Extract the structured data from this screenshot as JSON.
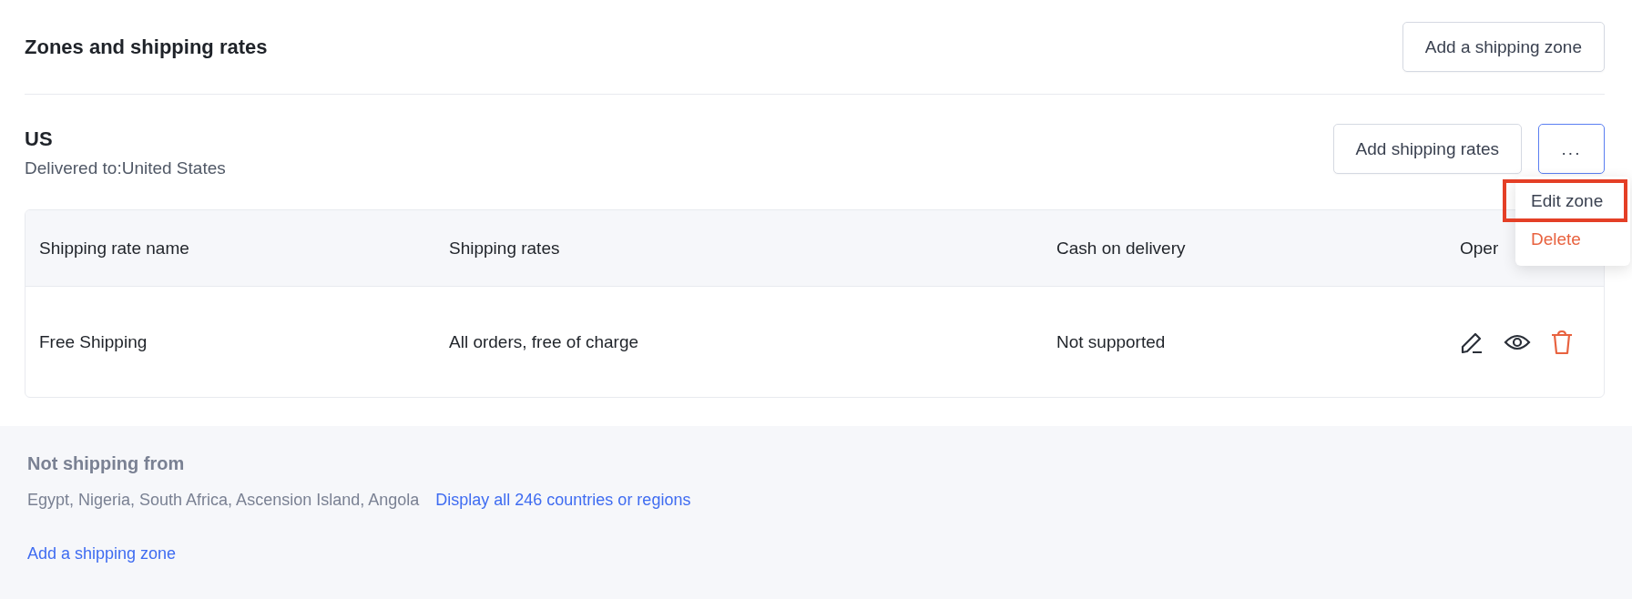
{
  "header": {
    "title": "Zones and shipping rates",
    "button": "Add a shipping zone"
  },
  "zone": {
    "name": "US",
    "delivered_to": "Delivered to:United States",
    "add_rates_button": "Add shipping rates",
    "more_button": "...",
    "menu": {
      "items": [
        {
          "label": "Edit zone",
          "kind": "normal",
          "highlighted": true
        },
        {
          "label": "Delete",
          "kind": "danger",
          "highlighted": false
        }
      ]
    }
  },
  "table": {
    "columns": [
      "Shipping rate name",
      "Shipping rates",
      "Cash on delivery",
      "Oper"
    ],
    "rows": [
      {
        "cells": [
          "Free Shipping",
          "All orders, free of charge",
          "Not supported"
        ],
        "actions": [
          {
            "kind": "edit"
          },
          {
            "kind": "view"
          },
          {
            "kind": "delete"
          }
        ]
      }
    ]
  },
  "not_shipping": {
    "title": "Not shipping from",
    "countries": "Egypt, Nigeria, South Africa, Ascension Island, Angola",
    "link": "Display all 246 countries or regions",
    "add_link": "Add a shipping zone"
  }
}
